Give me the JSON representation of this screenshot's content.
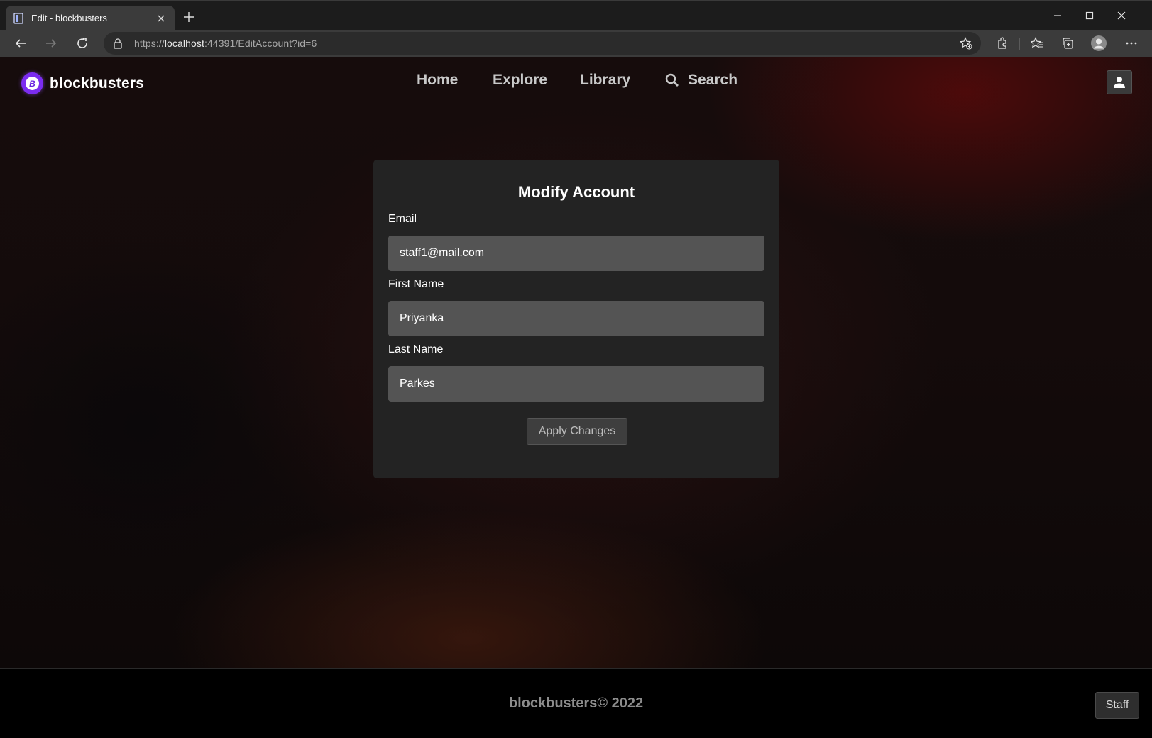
{
  "browser": {
    "tab_title": "Edit - blockbusters",
    "url_scheme": "https://",
    "url_host": "localhost",
    "url_rest": ":44391/EditAccount?id=6"
  },
  "site": {
    "brand": "blockbusters",
    "logo_letter": "B",
    "logo_color": "#7b2cf0",
    "nav": {
      "home": "Home",
      "explore": "Explore",
      "library": "Library",
      "search": "Search"
    }
  },
  "form": {
    "title": "Modify Account",
    "email_label": "Email",
    "email_value": "staff1@mail.com",
    "first_name_label": "First Name",
    "first_name_value": "Priyanka",
    "last_name_label": "Last Name",
    "last_name_value": "Parkes",
    "submit_label": "Apply Changes"
  },
  "footer": {
    "copyright": "blockbusters© 2022",
    "staff_label": "Staff"
  }
}
